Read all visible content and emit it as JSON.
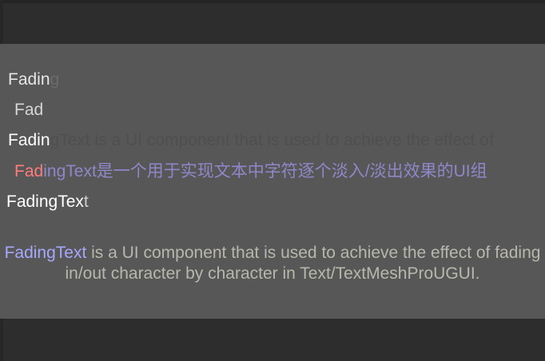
{
  "lines": [
    {
      "text": "Fading",
      "visible_chars": 5,
      "color": "#e6e6e6",
      "faded_color": "#6a6a6a"
    },
    {
      "text": "Fad",
      "visible_chars": 3,
      "color": "#d6d6d6",
      "faded_color": "#707070"
    },
    {
      "text": "Fadin",
      "visible_chars": 5,
      "color": "#ffffff",
      "faded_color": "#6a6a6a"
    },
    {
      "text": "FadingText是一个用于实现文本中字符逐个淡入/淡出效果的UI组",
      "color": "#8f87c9",
      "gradient_start": "#ff7c7c"
    },
    {
      "text": "FadingText",
      "visible_chars": 9,
      "color": "#ffffff",
      "faded_color": "#cfcfcf"
    }
  ],
  "ghost_text": "FadingText is a UI component that is used to achieve the effect of",
  "description": {
    "highlight": "FadingText",
    "rest": " is a UI component that is used to achieve the effect of fading in/out character by character in Text/TextMeshProUGUI."
  },
  "colors": {
    "background": "#2d2d2d",
    "panel": "#575757",
    "accent": "#a7a7ff",
    "text": "#b7b7ad"
  }
}
